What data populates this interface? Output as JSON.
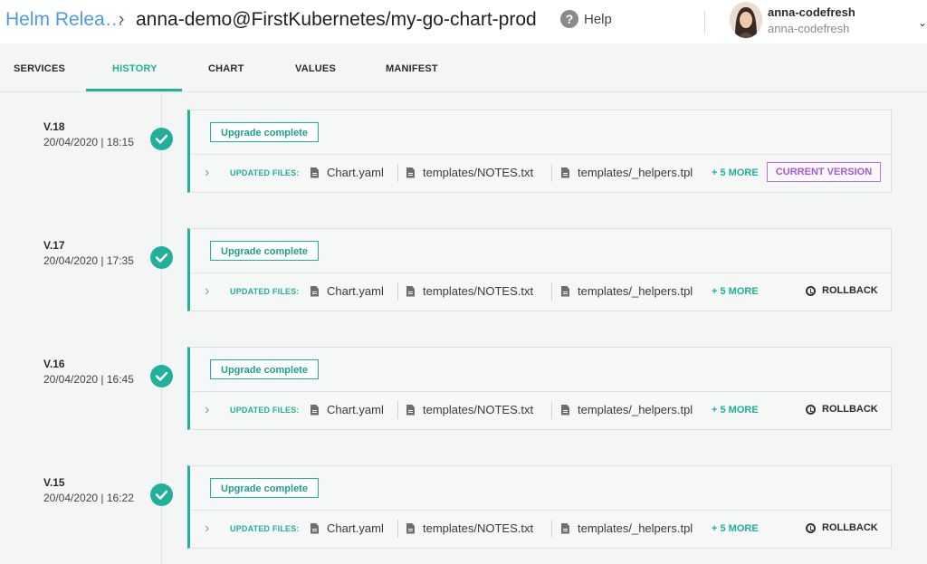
{
  "header": {
    "breadcrumb_root": "Helm Relea…",
    "breadcrumb_separator": "›",
    "breadcrumb_current": "anna-demo@FirstKubernetes/my-go-chart-prod",
    "help_label": "Help",
    "help_icon": "?",
    "user_name": "anna-codefresh",
    "user_subtitle": "anna-codefresh",
    "user_menu_icon": "⌄"
  },
  "tabs": [
    {
      "label": "SERVICES"
    },
    {
      "label": "HISTORY",
      "active": true
    },
    {
      "label": "CHART"
    },
    {
      "label": "VALUES"
    },
    {
      "label": "MANIFEST"
    }
  ],
  "colors": {
    "accent": "#20b09c",
    "link": "#4f9be2",
    "current_version": "#a65bd4"
  },
  "history": [
    {
      "version": "V.18",
      "date": "20/04/2020 | 18:15",
      "status": "Upgrade complete",
      "files_label": "UPDATED FILES:",
      "files": [
        "Chart.yaml",
        "templates/NOTES.txt",
        "templates/_helpers.tpl"
      ],
      "more": "+ 5 MORE",
      "action": "CURRENT VERSION"
    },
    {
      "version": "V.17",
      "date": "20/04/2020 | 17:35",
      "status": "Upgrade complete",
      "files_label": "UPDATED FILES:",
      "files": [
        "Chart.yaml",
        "templates/NOTES.txt",
        "templates/_helpers.tpl"
      ],
      "more": "+ 5 MORE",
      "action": "ROLLBACK"
    },
    {
      "version": "V.16",
      "date": "20/04/2020 | 16:45",
      "status": "Upgrade complete",
      "files_label": "UPDATED FILES:",
      "files": [
        "Chart.yaml",
        "templates/NOTES.txt",
        "templates/_helpers.tpl"
      ],
      "more": "+ 5 MORE",
      "action": "ROLLBACK"
    },
    {
      "version": "V.15",
      "date": "20/04/2020 | 16:22",
      "status": "Upgrade complete",
      "files_label": "UPDATED FILES:",
      "files": [
        "Chart.yaml",
        "templates/NOTES.txt",
        "templates/_helpers.tpl"
      ],
      "more": "+ 5 MORE",
      "action": "ROLLBACK"
    }
  ],
  "icons": {
    "success": "check-circle-icon",
    "file": "file-icon",
    "expand": "chevron-right-icon",
    "rollback": "history-icon"
  }
}
